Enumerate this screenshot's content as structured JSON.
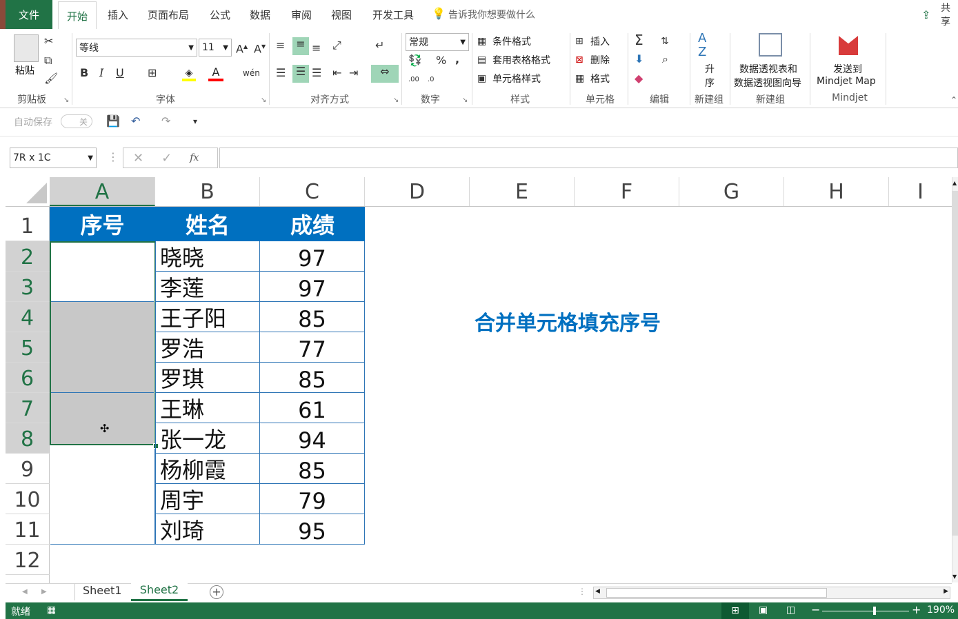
{
  "tabs": {
    "file": "文件",
    "items": [
      "开始",
      "插入",
      "页面布局",
      "公式",
      "数据",
      "审阅",
      "视图",
      "开发工具"
    ],
    "tell_me": "告诉我你想要做什么",
    "share": "共享"
  },
  "ribbon": {
    "clipboard": {
      "paste": "粘贴",
      "label": "剪贴板"
    },
    "font": {
      "name": "等线",
      "size": "11",
      "bold": "B",
      "italic": "I",
      "underline": "U",
      "label": "字体"
    },
    "alignment": {
      "label": "对齐方式"
    },
    "number": {
      "format": "常规",
      "percent": "%",
      "comma": ",",
      "label": "数字"
    },
    "styles": {
      "conditional": "条件格式",
      "table": "套用表格格式",
      "cell": "单元格样式",
      "label": "样式"
    },
    "cells": {
      "insert": "插入",
      "delete": "删除",
      "format": "格式",
      "label": "单元格"
    },
    "editing": {
      "label": "编辑"
    },
    "sort": {
      "line1": "升",
      "line2": "序",
      "label": "新建组"
    },
    "pivot": {
      "line1": "数据透视表和",
      "line2": "数据透视图向导",
      "label": "新建组"
    },
    "mindjet": {
      "line1": "发送到",
      "line2": "Mindjet Map",
      "label": "Mindjet"
    }
  },
  "qat": {
    "autosave": "自动保存",
    "toggle": "关"
  },
  "formula_bar": {
    "name_box": "7R x 1C",
    "fx": "fx",
    "content": ""
  },
  "columns": [
    "A",
    "B",
    "C",
    "D",
    "E",
    "F",
    "G",
    "H",
    "I"
  ],
  "rows": [
    "1",
    "2",
    "3",
    "4",
    "5",
    "6",
    "7",
    "8",
    "9",
    "10",
    "11",
    "12"
  ],
  "table": {
    "headers": [
      "序号",
      "姓名",
      "成绩"
    ],
    "names": [
      "晓晓",
      "李莲",
      "王子阳",
      "罗浩",
      "罗琪",
      "王琳",
      "张一龙",
      "杨柳霞",
      "周宇",
      "刘琦"
    ],
    "scores": [
      "97",
      "97",
      "85",
      "77",
      "85",
      "61",
      "94",
      "85",
      "79",
      "95"
    ]
  },
  "annotation": "合并单元格填充序号",
  "sheets": [
    "Sheet1",
    "Sheet2"
  ],
  "status": {
    "ready": "就绪",
    "zoom": "190%"
  },
  "colors": {
    "excel_green": "#217346",
    "header_blue": "#0070c0",
    "annotation_blue": "#0070c0",
    "selection_gray": "#c8c8c8"
  }
}
